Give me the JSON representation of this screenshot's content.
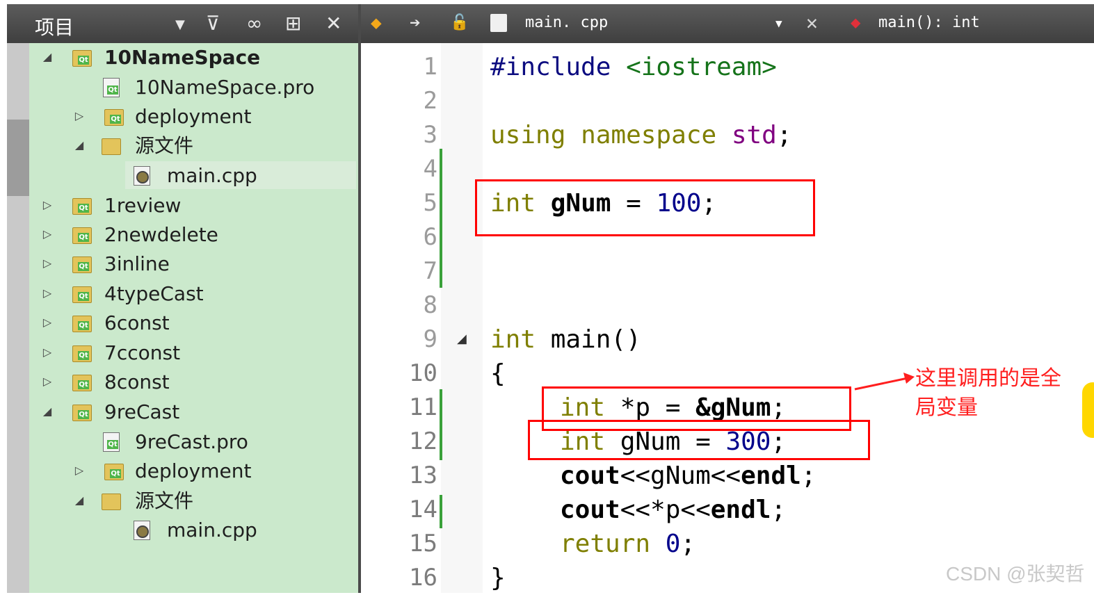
{
  "project_panel": {
    "title": "项目",
    "tree": [
      {
        "label": "10NameSpace",
        "icon": "qt-folder-icon",
        "expanded": true,
        "bold": true
      },
      {
        "label": "10NameSpace.pro",
        "icon": "pro-file-icon"
      },
      {
        "label": "deployment",
        "icon": "qt-folder-icon",
        "expanded": false
      },
      {
        "label": "源文件",
        "icon": "cpp-folder-icon",
        "expanded": true
      },
      {
        "label": "main.cpp",
        "icon": "cpp-file-icon",
        "selected": true
      },
      {
        "label": "1review",
        "icon": "qt-folder-icon",
        "expanded": false
      },
      {
        "label": "2newdelete",
        "icon": "qt-folder-icon",
        "expanded": false
      },
      {
        "label": "3inline",
        "icon": "qt-folder-icon",
        "expanded": false
      },
      {
        "label": "4typeCast",
        "icon": "qt-folder-icon",
        "expanded": false
      },
      {
        "label": "6const",
        "icon": "qt-folder-icon",
        "expanded": false
      },
      {
        "label": "7cconst",
        "icon": "qt-folder-icon",
        "expanded": false
      },
      {
        "label": "8const",
        "icon": "qt-folder-icon",
        "expanded": false
      },
      {
        "label": "9reCast",
        "icon": "qt-folder-icon",
        "expanded": true
      },
      {
        "label": "9reCast.pro",
        "icon": "pro-file-icon"
      },
      {
        "label": "deployment",
        "icon": "qt-folder-icon",
        "expanded": false
      },
      {
        "label": "源文件",
        "icon": "cpp-folder-icon",
        "expanded": true
      },
      {
        "label": "main.cpp",
        "icon": "cpp-file-icon"
      }
    ]
  },
  "editor": {
    "file_name": "main. cpp",
    "function_scope": "main(): int",
    "line_numbers": [
      "1",
      "2",
      "3",
      "4",
      "5",
      "6",
      "7",
      "8",
      "9",
      "10",
      "11",
      "12",
      "13",
      "14",
      "15",
      "16"
    ],
    "code": {
      "l1_directive": "#include",
      "l1_header": "<iostream>",
      "l3_using": "using",
      "l3_namespace": "namespace",
      "l3_std": "std",
      "l3_semi": ";",
      "l5_int": "int",
      "l5_name": "gNum",
      "l5_eq": " = ",
      "l5_val": "100",
      "l5_semi": ";",
      "l9_int": "int",
      "l9_main": " main()",
      "l10_brace": "{",
      "l11_int": "int",
      "l11_mid": " *p = ",
      "l11_ref": "&gNum",
      "l11_semi": ";",
      "l12_int": "int",
      "l12_name": " gNum",
      "l12_eq": " = ",
      "l12_val": "300",
      "l12_semi": ";",
      "l13_cout": "cout",
      "l13_mid": "<<gNum<<",
      "l13_endl": "endl",
      "l13_semi": ";",
      "l14_cout": "cout",
      "l14_mid": "<<*p<<",
      "l14_endl": "endl",
      "l14_semi": ";",
      "l15_return": "return",
      "l15_val": "0",
      "l15_semi": ";",
      "l16_brace": "}"
    }
  },
  "annotation": {
    "text": "这里调用的是全局变量",
    "color": "#ff1e1e"
  },
  "watermark": "CSDN @张契哲",
  "colors": {
    "tree_background": "#cbe9cc",
    "header_background": "#4a4a4a",
    "highlight_box": "#ff0000",
    "change_marker": "#3aa13a"
  }
}
